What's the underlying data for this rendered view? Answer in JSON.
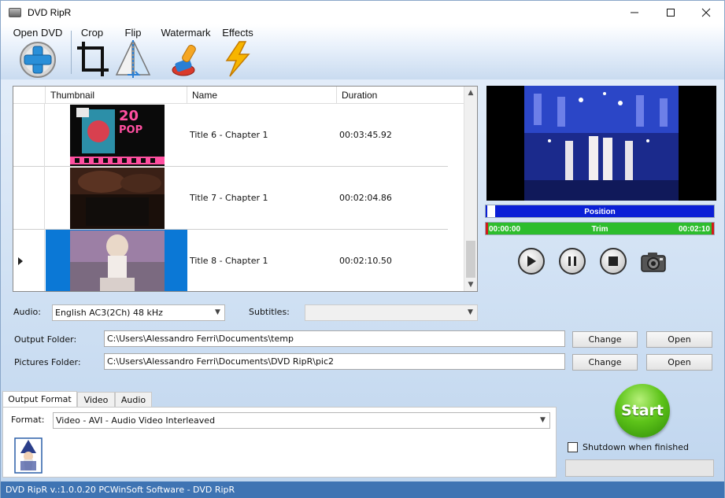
{
  "window": {
    "title": "DVD RipR",
    "minimize_icon": "minimize-icon",
    "maximize_icon": "maximize-icon",
    "close_icon": "close-icon"
  },
  "toolbar": {
    "items": [
      {
        "label": "Open DVD",
        "icon": "plus-disc-icon"
      },
      {
        "label": "Crop",
        "icon": "crop-icon"
      },
      {
        "label": "Flip",
        "icon": "flip-icon"
      },
      {
        "label": "Watermark",
        "icon": "stamp-icon"
      },
      {
        "label": "Effects",
        "icon": "lightning-icon"
      }
    ]
  },
  "grid": {
    "columns": [
      "Thumbnail",
      "Name",
      "Duration"
    ],
    "rows": [
      {
        "name": "Title 6 - Chapter 1",
        "duration": "00:03:45.92",
        "selected": false
      },
      {
        "name": "Title 7 - Chapter 1",
        "duration": "00:02:04.86",
        "selected": false
      },
      {
        "name": "Title 8 - Chapter 1",
        "duration": "00:02:10.50",
        "selected": true
      }
    ]
  },
  "player": {
    "position_label": "Position",
    "position_fraction": 0.0,
    "trim_label": "Trim",
    "trim_start": "00:00:00",
    "trim_end": "00:02:10",
    "position_color": "#0a1fd6",
    "trim_color": "#2dbd2d"
  },
  "form": {
    "audio_label": "Audio:",
    "audio_value": "English AC3(2Ch) 48 kHz",
    "subtitles_label": "Subtitles:",
    "subtitles_value": "",
    "output_folder_label": "Output Folder:",
    "output_folder_value": "C:\\Users\\Alessandro Ferri\\Documents\\temp",
    "pictures_folder_label": "Pictures Folder:",
    "pictures_folder_value": "C:\\Users\\Alessandro Ferri\\Documents\\DVD RipR\\pic2",
    "change_label": "Change",
    "open_label": "Open"
  },
  "tabs": [
    "Output Format",
    "Video",
    "Audio"
  ],
  "format": {
    "label": "Format:",
    "value": "Video - AVI - Audio Video Interleaved"
  },
  "start": {
    "label": "Start",
    "color": "#5ec41a"
  },
  "shutdown_label": "Shutdown when finished",
  "status_text": "DVD RipR v.:1.0.0.20 PCWinSoft Software - DVD RipR"
}
